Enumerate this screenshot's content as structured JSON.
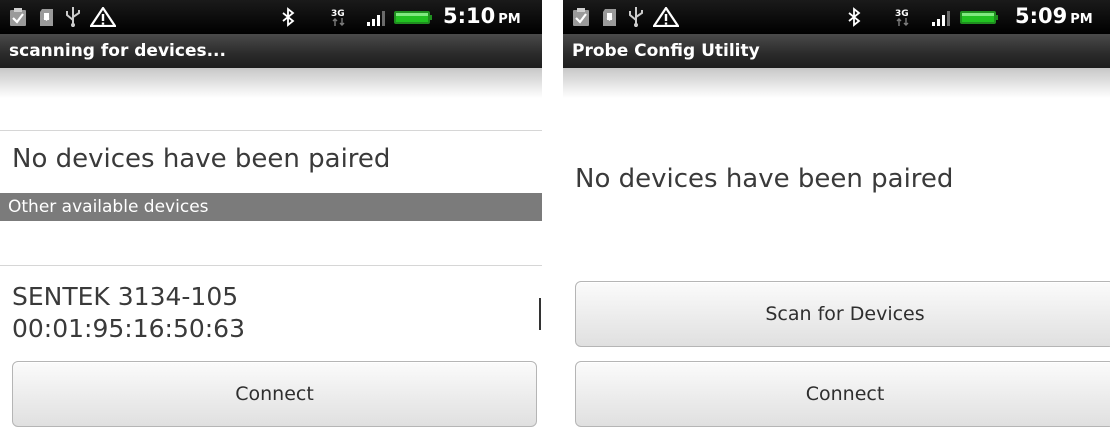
{
  "left": {
    "status": {
      "time": "5:10",
      "ampm": "PM",
      "network": "3G"
    },
    "title": "scanning for devices...",
    "paired_message": "No devices have been paired",
    "other_header": "Other available devices",
    "device": {
      "name": "SENTEK 3134-105",
      "address": "00:01:95:16:50:63"
    },
    "connect_label": "Connect"
  },
  "right": {
    "status": {
      "time": "5:09",
      "ampm": "PM",
      "network": "3G"
    },
    "title": "Probe Config Utility",
    "paired_message": "No devices have been paired",
    "scan_label": "Scan for Devices",
    "connect_label": "Connect"
  },
  "icons": [
    "clipboard-check-icon",
    "sd-card-icon",
    "usb-icon",
    "warning-icon",
    "bluetooth-icon",
    "network-3g-icon",
    "signal-bars-icon",
    "battery-icon"
  ],
  "colors": {
    "battery": "#22c322",
    "section_header": "#7b7b7b",
    "title_bar": "#2a2a2a"
  }
}
